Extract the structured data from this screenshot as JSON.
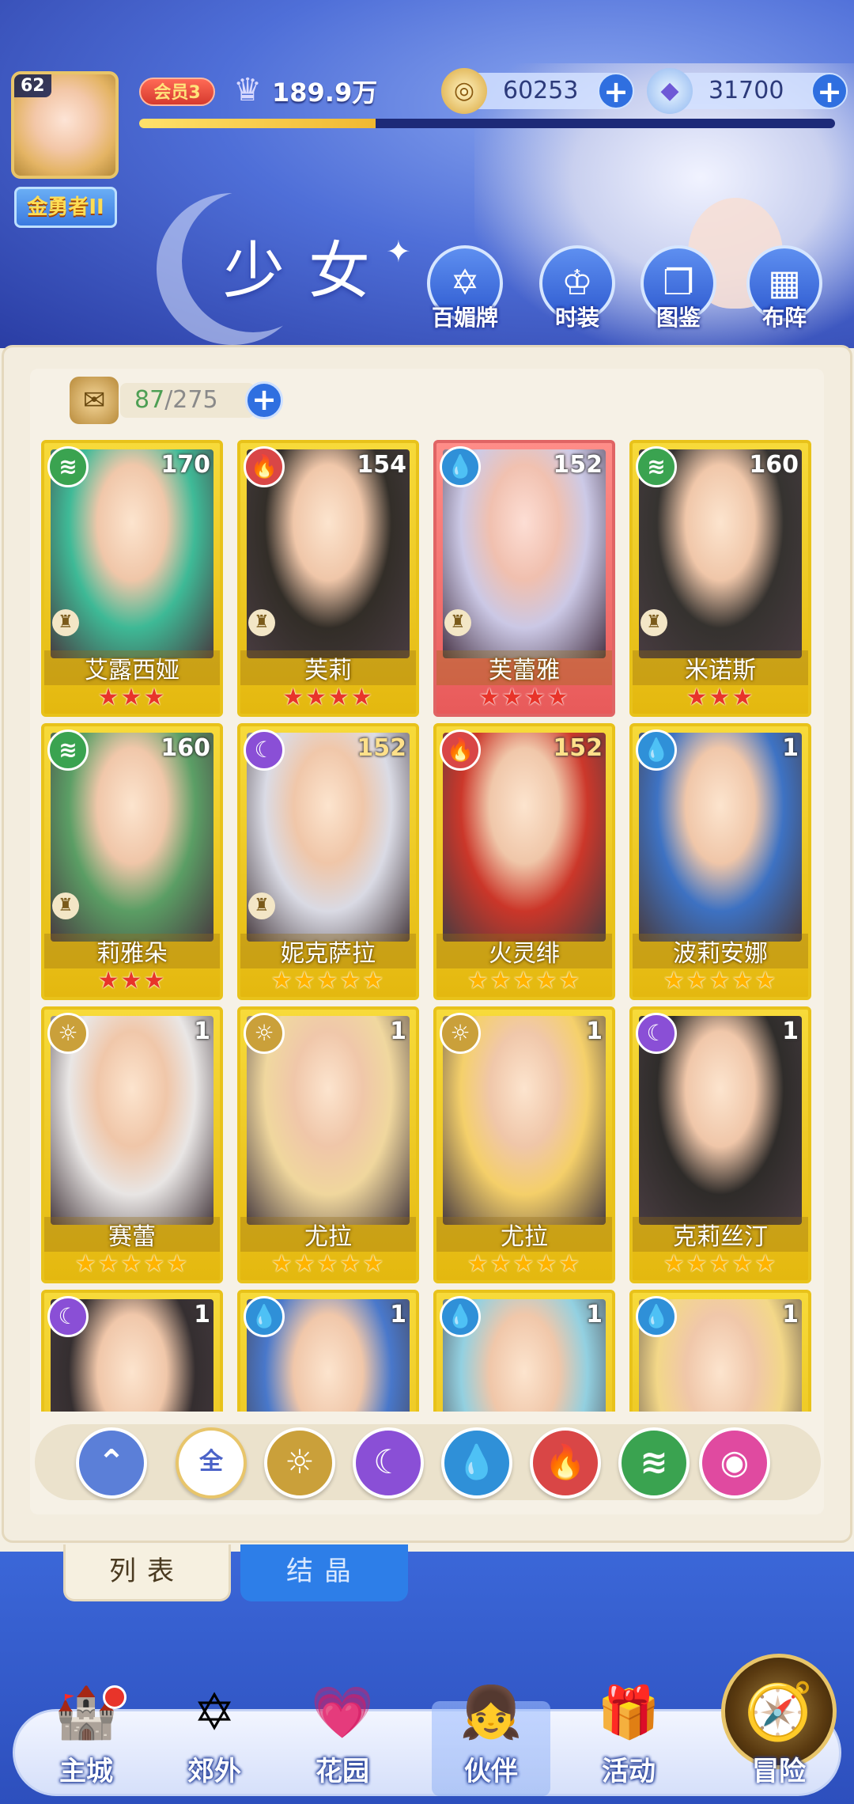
{
  "header": {
    "level": "62",
    "rank": "金勇者II",
    "vip": "会员3",
    "power": "189.9万",
    "xp_progress": 0.34,
    "gold": "60253",
    "gems": "31700",
    "title": "少女",
    "buttons": [
      {
        "label": "百媚牌",
        "icon": "card-icon"
      },
      {
        "label": "时装",
        "icon": "outfit-icon"
      },
      {
        "label": "图鉴",
        "icon": "book-icon"
      },
      {
        "label": "布阵",
        "icon": "formation-icon"
      }
    ]
  },
  "capacity": {
    "current": "87",
    "max": "/275"
  },
  "cards": [
    {
      "name": "艾露西娅",
      "level": "170",
      "element": "wind",
      "stars": "★★★",
      "star_color": "red",
      "hair": "#2fb8a0",
      "rank_icon": true
    },
    {
      "name": "芙莉",
      "level": "154",
      "element": "fire",
      "stars": "★★★★",
      "star_color": "red",
      "hair": "#222028",
      "rank_icon": true
    },
    {
      "name": "芙蕾雅",
      "level": "152",
      "element": "water",
      "stars": "★★★★",
      "star_color": "red",
      "hair": "#c8d0f0",
      "rank_icon": true,
      "red": true
    },
    {
      "name": "米诺斯",
      "level": "160",
      "element": "wind",
      "stars": "★★★",
      "star_color": "red",
      "hair": "#252530",
      "rank_icon": true
    },
    {
      "name": "莉雅朵",
      "level": "160",
      "element": "wind",
      "stars": "★★★",
      "star_color": "red",
      "hair": "#4e9a6a",
      "rank_icon": true
    },
    {
      "name": "妮克萨拉",
      "level": "152",
      "element": "moon",
      "stars": "★★★★★",
      "star_color": "gold",
      "hair": "#d8dcf5",
      "rank_icon": true,
      "lv_gold": true
    },
    {
      "name": "火灵绯",
      "level": "152",
      "element": "fire",
      "stars": "★★★★★",
      "star_color": "gold",
      "hair": "#c82a2a",
      "lv_gold": true
    },
    {
      "name": "波莉安娜",
      "level": "1",
      "element": "water",
      "stars": "★★★★★",
      "star_color": "gold",
      "hair": "#2e6ad0"
    },
    {
      "name": "赛蕾",
      "level": "1",
      "element": "sun",
      "stars": "★★★★★",
      "star_color": "gold",
      "hair": "#e8e8f5"
    },
    {
      "name": "尤拉",
      "level": "1",
      "element": "sun",
      "stars": "★★★★★",
      "star_color": "gold",
      "hair": "#f0d8a8"
    },
    {
      "name": "尤拉",
      "level": "1",
      "element": "sun",
      "stars": "★★★★★",
      "star_color": "gold",
      "hair": "#f5d070"
    },
    {
      "name": "克莉丝汀",
      "level": "1",
      "element": "moon",
      "stars": "★★★★★",
      "star_color": "gold",
      "hair": "#1e1e2a"
    },
    {
      "name": "",
      "level": "1",
      "element": "moon",
      "stars": "",
      "star_color": "gold",
      "hair": "#242030"
    },
    {
      "name": "",
      "level": "1",
      "element": "water",
      "stars": "",
      "star_color": "gold",
      "hair": "#3a70d8"
    },
    {
      "name": "",
      "level": "1",
      "element": "water",
      "stars": "",
      "star_color": "gold",
      "hair": "#8ad0f0"
    },
    {
      "name": "",
      "level": "1",
      "element": "water",
      "stars": "",
      "star_color": "gold",
      "hair": "#f3d890"
    }
  ],
  "filters": [
    {
      "name": "filter-collapse",
      "icon": "collapse-icon",
      "glyph": "⌃",
      "color": "#5b7fd8"
    },
    {
      "name": "filter-all",
      "label": "全",
      "icon": "all-icon"
    },
    {
      "name": "filter-sun",
      "icon": "sun-icon",
      "glyph": "☼",
      "color": "#caa03a"
    },
    {
      "name": "filter-moon",
      "icon": "moon-icon",
      "glyph": "☾",
      "color": "#8a4fd6"
    },
    {
      "name": "filter-water",
      "icon": "water-drop-icon",
      "glyph": "💧",
      "color": "#2f90d8"
    },
    {
      "name": "filter-fire",
      "icon": "fire-icon",
      "glyph": "🔥",
      "color": "#d94646"
    },
    {
      "name": "filter-wind",
      "icon": "wind-icon",
      "glyph": "≋",
      "color": "#3aa350"
    },
    {
      "name": "filter-star",
      "icon": "star-orb-icon",
      "glyph": "◉",
      "color": "#e04aa0"
    }
  ],
  "tabs": {
    "list": "列表",
    "crystal": "结晶"
  },
  "nav": [
    {
      "label": "主城",
      "icon": "castle-icon",
      "glyph": "🏰",
      "badge": true
    },
    {
      "label": "郊外",
      "icon": "portal-icon",
      "glyph": "✡"
    },
    {
      "label": "花园",
      "icon": "heart-icon",
      "glyph": "💗"
    },
    {
      "label": "伙伴",
      "icon": "partner-icon",
      "glyph": "👧",
      "active": true
    },
    {
      "label": "活动",
      "icon": "gift-icon",
      "glyph": "🎁"
    },
    {
      "label": "冒险",
      "icon": "compass-icon",
      "glyph": "🧭"
    }
  ]
}
